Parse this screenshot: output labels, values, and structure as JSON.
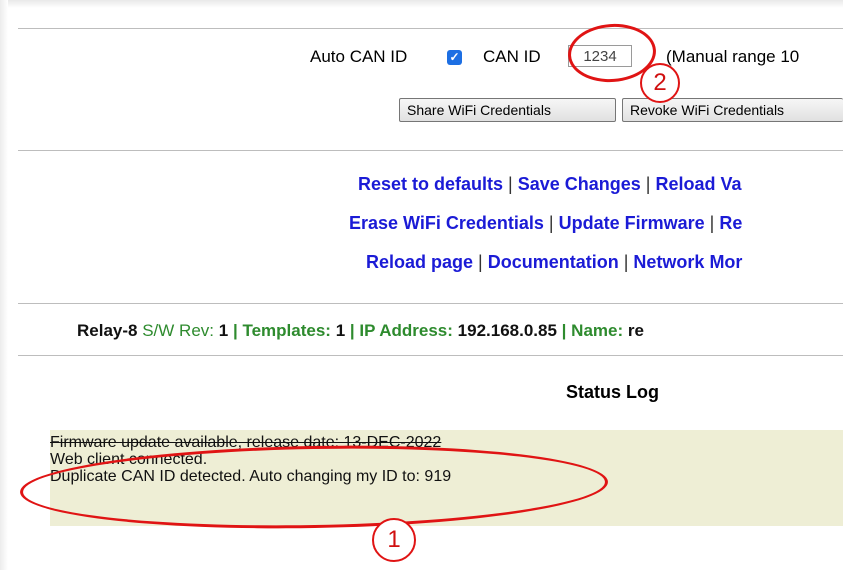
{
  "can": {
    "auto_label": "Auto CAN ID",
    "can_id_label": "CAN ID",
    "can_id_value": "1234",
    "manual_range": "(Manual range 10"
  },
  "wifi": {
    "share_label": "Share WiFi Credentials",
    "revoke_label": "Revoke WiFi Credentials"
  },
  "links": {
    "row1": [
      "Reset to defaults",
      "Save Changes",
      "Reload Va"
    ],
    "row2": [
      "Erase WiFi Credentials",
      "Update Firmware",
      "Re"
    ],
    "row3": [
      "Reload page",
      "Documentation",
      "Network Mor"
    ]
  },
  "info": {
    "device": "Relay-8",
    "sw_rev_label": "S/W Rev:",
    "sw_rev": "1",
    "templates_label": "Templates:",
    "templates": "1",
    "ip_label": "IP Address:",
    "ip": "192.168.0.85",
    "name_label": "Name:",
    "name": "re"
  },
  "status": {
    "title": "Status Log",
    "lines": [
      "Firmware update available, release date: 13-DEC-2022",
      "Web client connected.",
      "Duplicate CAN ID detected. Auto changing my ID to: 919"
    ]
  },
  "annotations": {
    "badge1": "1",
    "badge2": "2",
    "color": "#e01414"
  },
  "colors": {
    "link": "#1b1bd6",
    "green": "#2e8b2e",
    "log_bg": "#eeeed5",
    "checkbox": "#1d6fe3"
  }
}
